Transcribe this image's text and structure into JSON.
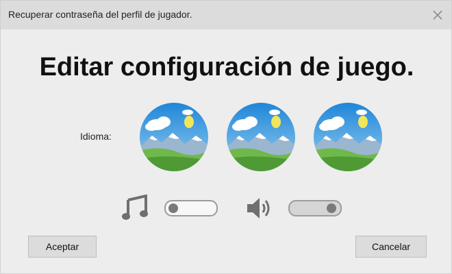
{
  "window": {
    "title": "Recuperar contraseña del perfil de jugador."
  },
  "main": {
    "heading": "Editar configuración de juego.",
    "language_label": "Idioma:",
    "language_options": [
      {
        "icon": "landscape-image"
      },
      {
        "icon": "landscape-image"
      },
      {
        "icon": "landscape-image"
      }
    ],
    "music": {
      "icon": "music-note-icon",
      "toggle_state": "off"
    },
    "sound": {
      "icon": "speaker-icon",
      "toggle_state": "on"
    }
  },
  "footer": {
    "accept_label": "Aceptar",
    "cancel_label": "Cancelar"
  },
  "colors": {
    "background": "#ededed",
    "titlebar": "#dcdcdc",
    "icon_gray": "#6f6f6f",
    "sky": "#2f9be0",
    "grass": "#5aa83a"
  }
}
